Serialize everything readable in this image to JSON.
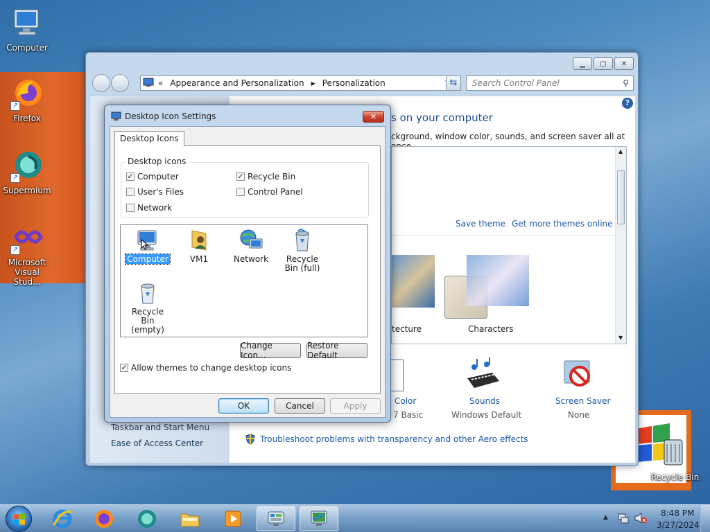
{
  "desktop": {
    "icons": [
      {
        "label": "Computer"
      },
      {
        "label": "Firefox"
      },
      {
        "label": "Supermium"
      },
      {
        "label": "Microsoft Visual Stud..."
      },
      {
        "label": "Recycle Bin"
      }
    ]
  },
  "control_panel": {
    "breadcrumb_prefix": "«",
    "breadcrumb": [
      "Appearance and Personalization",
      "Personalization"
    ],
    "search_placeholder": "Search Control Panel",
    "heading_tail": "s on your computer",
    "subtitle_tail": "ckground, window color, sounds, and screen saver all at once.",
    "theme_links": {
      "save": "Save theme",
      "more": "Get more themes online"
    },
    "themes": [
      {
        "label": "tecture"
      },
      {
        "label": "Characters"
      }
    ],
    "bottom_items": [
      {
        "label": "Color",
        "sub": "7 Basic"
      },
      {
        "label": "Sounds",
        "sub": "Windows Default"
      },
      {
        "label": "Screen Saver",
        "sub": "None"
      }
    ],
    "left_links": [
      "Taskbar and Start Menu",
      "Ease of Access Center"
    ],
    "troubleshoot": "Troubleshoot problems with transparency and other Aero effects"
  },
  "dialog": {
    "title": "Desktop Icon Settings",
    "tab": "Desktop Icons",
    "group_label": "Desktop icons",
    "checkboxes": [
      {
        "label": "Computer",
        "checked": true
      },
      {
        "label": "Recycle Bin",
        "checked": true
      },
      {
        "label": "User's Files",
        "checked": false
      },
      {
        "label": "Control Panel",
        "checked": false
      },
      {
        "label": "Network",
        "checked": false
      }
    ],
    "icons": [
      {
        "label": "Computer"
      },
      {
        "label": "VM1"
      },
      {
        "label": "Network"
      },
      {
        "label": "Recycle Bin (full)"
      },
      {
        "label": "Recycle Bin (empty)"
      }
    ],
    "change_icon": "Change Icon...",
    "restore_default": "Restore Default",
    "allow_themes": "Allow themes to change desktop icons",
    "ok": "OK",
    "cancel": "Cancel",
    "apply": "Apply"
  },
  "taskbar": {
    "time": "8:48 PM",
    "date": "3/27/2024"
  }
}
